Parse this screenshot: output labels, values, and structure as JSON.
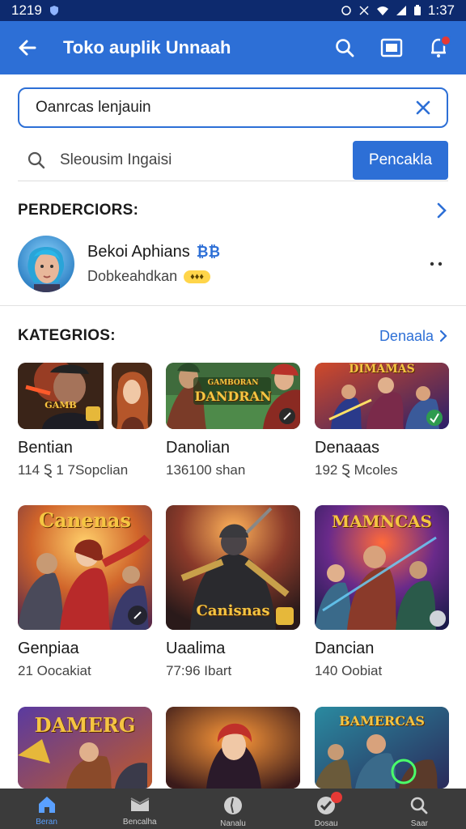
{
  "status_bar": {
    "time_left": "1219",
    "time_right": "1:37"
  },
  "app_bar": {
    "title": "Toko auplik Unnaah"
  },
  "search_box": {
    "value": "Oanrcas lenjauin"
  },
  "search_row": {
    "placeholder": "Sleousim Ingaisi",
    "button_label": "Pencakla"
  },
  "developers": {
    "heading": "PERDERCIORS:",
    "item": {
      "name": "Bekoi Aphians",
      "verified_mark": "₿₿",
      "subtitle": "Dobkeahdkan",
      "badge": "♦♦♦"
    }
  },
  "categories": {
    "heading": "KATEGRIOS:",
    "link": "Denaala",
    "items": [
      {
        "name": "Bentian",
        "meta": "114 Ȿ 1 7Sopclian",
        "art_label": "GAMB"
      },
      {
        "name": "Danolian",
        "meta": "136100 shan",
        "art_label": "DANDRAN",
        "art_sub": "GAMBORAN"
      },
      {
        "name": "Denaaas",
        "meta": "192 Ȿ Mcoles",
        "art_label": "DIMAMAS"
      },
      {
        "name": "Genpiaa",
        "meta": "21 Oocakiat",
        "art_label": "Canenas"
      },
      {
        "name": "Uaalima",
        "meta": "77:96 Ibart",
        "art_label": "Canisnas"
      },
      {
        "name": "Dancian",
        "meta": "140 Oobiat",
        "art_label": "MAMNCAS"
      },
      {
        "name": "",
        "meta": "",
        "art_label": "DAMERG"
      },
      {
        "name": "",
        "meta": "",
        "art_label": ""
      },
      {
        "name": "",
        "meta": "",
        "art_label": "BAMERCAS"
      }
    ]
  },
  "bottom_nav": {
    "items": [
      {
        "label": "Beran",
        "icon": "home-icon"
      },
      {
        "label": "Bencalha",
        "icon": "layers-icon"
      },
      {
        "label": "Nanalu",
        "icon": "compass-icon"
      },
      {
        "label": "Dosau",
        "icon": "check-badge-icon"
      },
      {
        "label": "Saar",
        "icon": "search-icon"
      }
    ]
  },
  "colors": {
    "primary": "#2d6fd6",
    "status_bar": "#0d2a6e",
    "nav_bg": "#3b3b3b",
    "badge_red": "#e53935"
  }
}
